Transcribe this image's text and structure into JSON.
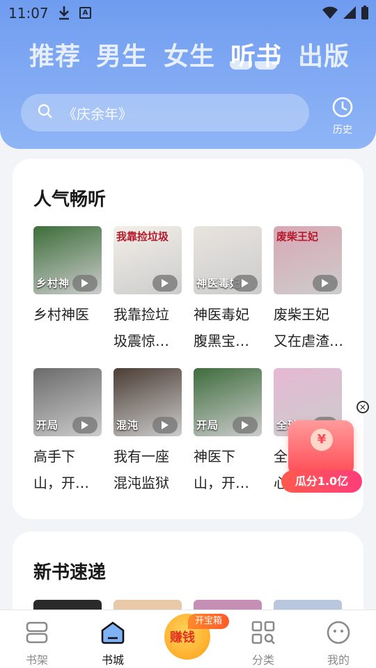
{
  "status_bar": {
    "time": "11:07",
    "a_icon_letter": "A"
  },
  "header": {
    "tabs": [
      {
        "label": "推荐",
        "active": false
      },
      {
        "label": "男生",
        "active": false
      },
      {
        "label": "女生",
        "active": false
      },
      {
        "label": "听书",
        "active": true
      },
      {
        "label": "出版",
        "active": false
      }
    ],
    "search": {
      "placeholder": "《庆余年》",
      "icon": "search-icon"
    },
    "history": {
      "label": "历史",
      "icon": "clock-icon"
    }
  },
  "popular": {
    "title": "人气畅听",
    "books": [
      {
        "title_line1": "乡村神医",
        "title_line2": "",
        "cover_text": "乡村神",
        "cover_color": "#3d6e3a"
      },
      {
        "title_line1": "我靠捡垃",
        "title_line2": "圾震惊…",
        "cover_text": "我靠捡垃圾",
        "cover_color": "#f3efe8"
      },
      {
        "title_line1": "神医毒妃",
        "title_line2": "腹黑宝…",
        "cover_text": "神医毒妃",
        "cover_color": "#e8e4df"
      },
      {
        "title_line1": "废柴王妃",
        "title_line2": "又在虐渣…",
        "cover_text": "废柴王妃",
        "cover_color": "#d9a7b4"
      },
      {
        "title_line1": "高手下",
        "title_line2": "山，开…",
        "cover_text": "开局",
        "cover_color": "#6b6b6b"
      },
      {
        "title_line1": "我有一座",
        "title_line2": "混沌监狱",
        "cover_text": "混沌",
        "cover_color": "#4b3d34"
      },
      {
        "title_line1": "神医下",
        "title_line2": "山，开…",
        "cover_text": "开局",
        "cover_color": "#3e6d3c"
      },
      {
        "title_line1": "全",
        "title_line2": "心",
        "cover_text": "全球通缉",
        "cover_color": "#e6b8d4"
      }
    ]
  },
  "new_books": {
    "title": "新书速递"
  },
  "promo": {
    "label": "瓜分1.0亿",
    "coin_symbol": "¥",
    "close_symbol": "×"
  },
  "bottom_nav": {
    "items": [
      {
        "label": "书架",
        "icon": "bookshelf-icon",
        "active": false
      },
      {
        "label": "书城",
        "icon": "bookstore-icon",
        "active": true
      },
      {
        "label": "分类",
        "icon": "category-icon",
        "active": false
      },
      {
        "label": "我的",
        "icon": "profile-icon",
        "active": false
      }
    ],
    "earn": {
      "label": "赚钱",
      "badge": "开宝箱"
    }
  },
  "colors": {
    "header_blue": "#7fa8f3",
    "accent_red": "#ff4757",
    "active_nav": "#111111"
  }
}
